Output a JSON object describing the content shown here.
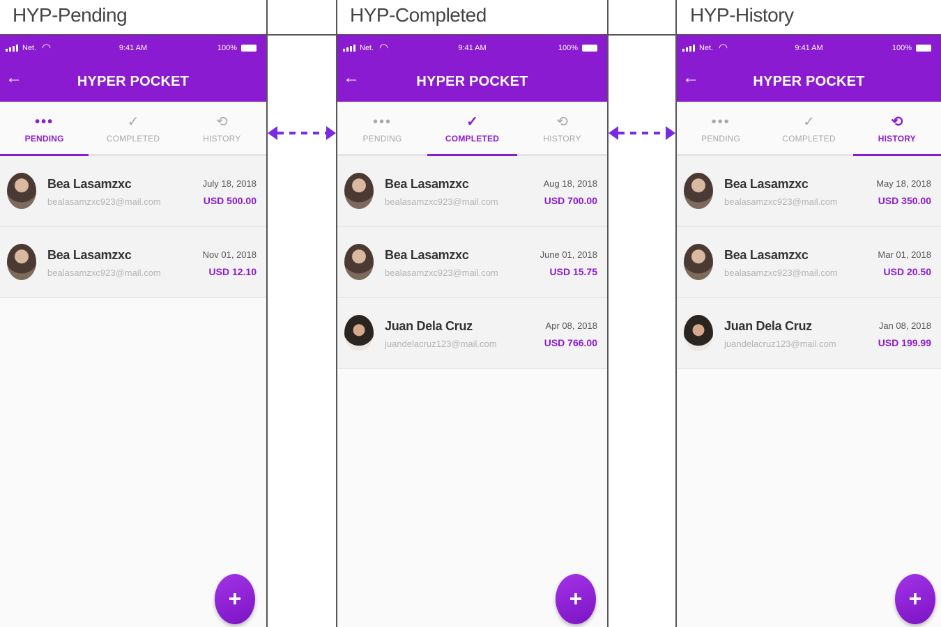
{
  "screens": [
    {
      "label": "HYP-Pending",
      "status": {
        "carrier": "Net.",
        "time": "9:41 AM",
        "battery": "100%"
      },
      "app_title": "HYPER POCKET",
      "tabs": [
        {
          "label": "PENDING",
          "icon": "dots-icon"
        },
        {
          "label": "COMPLETED",
          "icon": "check-icon"
        },
        {
          "label": "HISTORY",
          "icon": "history-icon"
        }
      ],
      "active_tab": "PENDING",
      "rows": [
        {
          "name": "Bea Lasamzxc",
          "email": "bealasamzxc923@mail.com",
          "date": "July 18, 2018",
          "amount": "USD 500.00"
        },
        {
          "name": "Bea Lasamzxc",
          "email": "bealasamzxc923@mail.com",
          "date": "Nov 01, 2018",
          "amount": "USD 12.10"
        }
      ],
      "fab": "+"
    },
    {
      "label": "HYP-Completed",
      "status": {
        "carrier": "Net.",
        "time": "9:41 AM",
        "battery": "100%"
      },
      "app_title": "HYPER POCKET",
      "tabs": [
        {
          "label": "PENDING",
          "icon": "dots-icon"
        },
        {
          "label": "COMPLETED",
          "icon": "check-icon"
        },
        {
          "label": "HISTORY",
          "icon": "history-icon"
        }
      ],
      "active_tab": "COMPLETED",
      "rows": [
        {
          "name": "Bea Lasamzxc",
          "email": "bealasamzxc923@mail.com",
          "date": "Aug 18, 2018",
          "amount": "USD 700.00"
        },
        {
          "name": "Bea Lasamzxc",
          "email": "bealasamzxc923@mail.com",
          "date": "June 01, 2018",
          "amount": "USD 15.75"
        },
        {
          "name": "Juan Dela Cruz",
          "email": "juandelacruz123@mail.com",
          "date": "Apr 08, 2018",
          "amount": "USD 766.00"
        }
      ],
      "fab": "+"
    },
    {
      "label": "HYP-History",
      "status": {
        "carrier": "Net.",
        "time": "9:41 AM",
        "battery": "100%"
      },
      "app_title": "HYPER POCKET",
      "tabs": [
        {
          "label": "PENDING",
          "icon": "dots-icon"
        },
        {
          "label": "COMPLETED",
          "icon": "check-icon"
        },
        {
          "label": "HISTORY",
          "icon": "history-icon"
        }
      ],
      "active_tab": "HISTORY",
      "rows": [
        {
          "name": "Bea Lasamzxc",
          "email": "bealasamzxc923@mail.com",
          "date": "May 18, 2018",
          "amount": "USD 350.00"
        },
        {
          "name": "Bea Lasamzxc",
          "email": "bealasamzxc923@mail.com",
          "date": "Mar 01, 2018",
          "amount": "USD 20.50"
        },
        {
          "name": "Juan Dela Cruz",
          "email": "juandelacruz123@mail.com",
          "date": "Jan 08, 2018",
          "amount": "USD 199.99"
        }
      ],
      "fab": "+"
    }
  ],
  "colors": {
    "accent": "#8a1bd0",
    "link_arrow": "#7a2be0"
  },
  "links": [
    {
      "icon": "double-arrow-icon"
    },
    {
      "icon": "double-arrow-icon"
    }
  ]
}
